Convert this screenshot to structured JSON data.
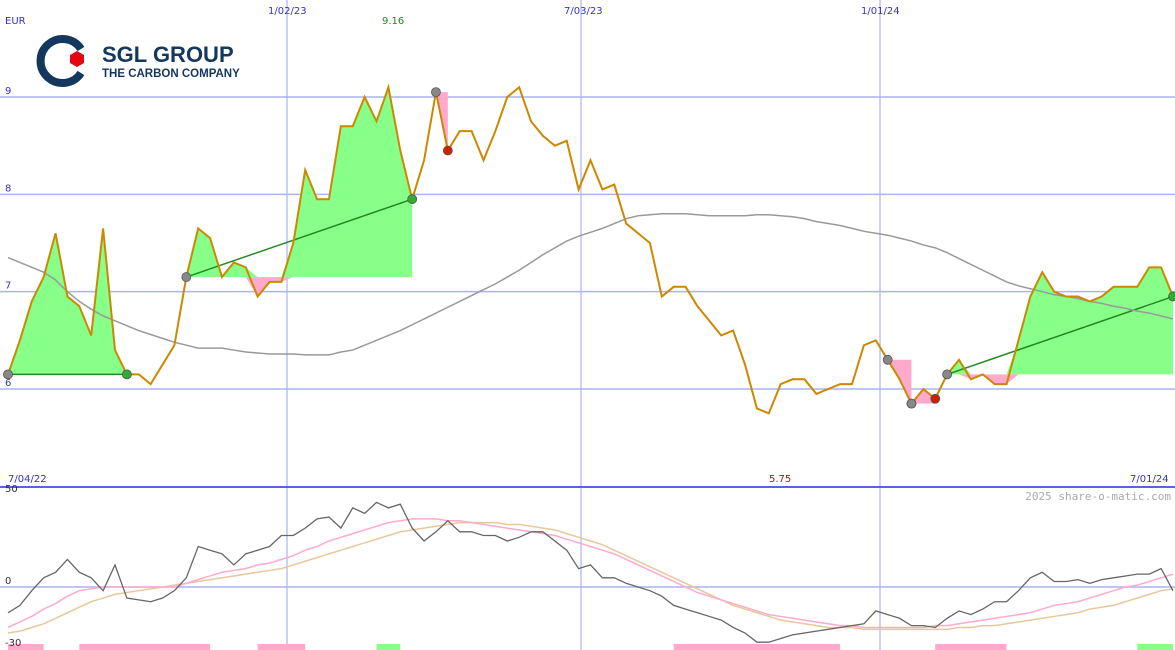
{
  "logo": {
    "name": "SGL GROUP",
    "tagline": "THE CARBON COMPANY"
  },
  "currency": "EUR",
  "copyright": "2025 share-o-matic.com",
  "top_date_labels": [
    "1/02/23",
    "7/03/23",
    "1/01/24"
  ],
  "start_label": "7/04/22",
  "end_label": "7/01/24",
  "high_label": "9.16",
  "low_label": "5.75",
  "colors": {
    "price": "#cc8800",
    "ma": "#999999",
    "grid": "#aab4ee",
    "axis": "#3333cc",
    "gain": "#88ff88",
    "loss": "#ffaacc",
    "macd": "#666666",
    "sig1": "#ffaacc",
    "sig2": "#e6c89a"
  },
  "chart_data": [
    {
      "type": "line",
      "ylim": [
        5.05,
        9.95
      ],
      "yticks": [
        6,
        7,
        8,
        9
      ],
      "x": [
        0,
        1,
        2,
        3,
        4,
        5,
        6,
        7,
        8,
        9,
        10,
        11,
        12,
        13,
        14,
        15,
        16,
        17,
        18,
        19,
        20,
        21,
        22,
        23,
        24,
        25,
        26,
        27,
        28,
        29,
        30,
        31,
        32,
        33,
        34,
        35,
        36,
        37,
        38,
        39,
        40,
        41,
        42,
        43,
        44,
        45,
        46,
        47,
        48,
        49,
        50,
        51,
        52,
        53,
        54,
        55,
        56,
        57,
        58,
        59,
        60,
        61,
        62,
        63,
        64,
        65,
        66,
        67,
        68,
        69,
        70,
        71,
        72,
        73,
        74,
        75,
        76,
        77,
        78,
        79,
        80,
        81,
        82,
        83,
        84,
        85,
        86,
        87,
        88,
        89,
        90,
        91,
        92,
        93,
        94,
        95,
        96,
        97,
        98
      ],
      "price": [
        6.15,
        6.5,
        6.9,
        7.15,
        7.6,
        6.95,
        6.85,
        6.55,
        7.65,
        6.4,
        6.15,
        6.15,
        6.05,
        6.25,
        6.45,
        7.15,
        7.65,
        7.55,
        7.15,
        7.3,
        7.25,
        6.95,
        7.1,
        7.1,
        7.5,
        8.25,
        7.95,
        7.95,
        8.7,
        8.7,
        9.0,
        8.75,
        9.1,
        8.45,
        7.95,
        8.35,
        9.05,
        8.45,
        8.65,
        8.65,
        8.35,
        8.65,
        9.0,
        9.1,
        8.75,
        8.6,
        8.5,
        8.55,
        8.05,
        8.35,
        8.05,
        8.1,
        7.7,
        7.6,
        7.5,
        6.95,
        7.05,
        7.05,
        6.85,
        6.7,
        6.55,
        6.6,
        6.25,
        5.8,
        5.75,
        6.05,
        6.1,
        6.1,
        5.95,
        6.0,
        6.05,
        6.05,
        6.45,
        6.5,
        6.3,
        6.1,
        5.85,
        6.0,
        5.9,
        6.15,
        6.3,
        6.1,
        6.15,
        6.05,
        6.05,
        6.5,
        6.95,
        7.2,
        7.0,
        6.95,
        6.95,
        6.9,
        6.95,
        7.05,
        7.05,
        7.05,
        7.25,
        7.25,
        6.95
      ],
      "moving_average": [
        7.35,
        7.3,
        7.25,
        7.2,
        7.12,
        7.0,
        6.9,
        6.82,
        6.75,
        6.7,
        6.65,
        6.6,
        6.56,
        6.52,
        6.48,
        6.45,
        6.42,
        6.42,
        6.42,
        6.4,
        6.38,
        6.37,
        6.36,
        6.36,
        6.36,
        6.35,
        6.35,
        6.35,
        6.38,
        6.4,
        6.45,
        6.5,
        6.55,
        6.6,
        6.66,
        6.72,
        6.78,
        6.84,
        6.9,
        6.96,
        7.02,
        7.08,
        7.15,
        7.22,
        7.3,
        7.38,
        7.45,
        7.52,
        7.57,
        7.61,
        7.65,
        7.7,
        7.75,
        7.78,
        7.79,
        7.8,
        7.8,
        7.8,
        7.79,
        7.78,
        7.78,
        7.78,
        7.78,
        7.79,
        7.79,
        7.78,
        7.77,
        7.75,
        7.72,
        7.7,
        7.68,
        7.65,
        7.62,
        7.6,
        7.58,
        7.55,
        7.52,
        7.48,
        7.45,
        7.4,
        7.34,
        7.28,
        7.22,
        7.16,
        7.1,
        7.06,
        7.03,
        7.0,
        6.97,
        6.95,
        6.93,
        6.9,
        6.88,
        6.85,
        6.83,
        6.8,
        6.78,
        6.75,
        6.72
      ],
      "buy_signals": [
        {
          "start": 0,
          "end": 10
        },
        {
          "start": 15,
          "end": 34
        },
        {
          "start": 79,
          "end": 98
        }
      ],
      "sell_signals": [
        {
          "start": 36,
          "end": 37
        },
        {
          "start": 74,
          "end": 76
        },
        {
          "start": 76,
          "end": 78
        }
      ]
    },
    {
      "type": "line",
      "ylim": [
        -30,
        50
      ],
      "yticks": [
        -30,
        0,
        50
      ],
      "macd": [
        -14,
        -10,
        -2,
        5,
        8,
        15,
        8,
        5,
        -2,
        12,
        -6,
        -7,
        -8,
        -6,
        -2,
        5,
        22,
        20,
        18,
        12,
        18,
        20,
        22,
        28,
        28,
        32,
        37,
        38,
        32,
        43,
        40,
        46,
        43,
        45,
        32,
        25,
        30,
        36,
        30,
        30,
        28,
        28,
        25,
        27,
        30,
        30,
        25,
        20,
        10,
        12,
        5,
        5,
        2,
        0,
        -2,
        -5,
        -10,
        -12,
        -14,
        -16,
        -18,
        -22,
        -25,
        -30,
        -30,
        -28,
        -26,
        -25,
        -24,
        -23,
        -22,
        -21,
        -20,
        -13,
        -15,
        -17,
        -21,
        -21,
        -22,
        -17,
        -13,
        -15,
        -12,
        -8,
        -8,
        -2,
        5,
        8,
        3,
        3,
        4,
        2,
        4,
        5,
        6,
        7,
        7,
        10,
        -2
      ],
      "signal_fast": [
        -22,
        -19,
        -16,
        -12,
        -9,
        -5,
        -2,
        -1,
        0,
        0,
        0,
        0,
        0,
        0,
        0,
        2,
        4,
        6,
        8,
        9,
        10,
        12,
        13,
        15,
        17,
        20,
        22,
        25,
        27,
        29,
        31,
        33,
        35,
        36,
        37,
        37,
        37,
        36,
        36,
        35,
        34,
        33,
        32,
        31,
        30,
        29,
        28,
        26,
        24,
        22,
        20,
        18,
        15,
        12,
        9,
        6,
        3,
        0,
        -3,
        -5,
        -7,
        -9,
        -11,
        -13,
        -15,
        -16,
        -17,
        -18,
        -19,
        -20,
        -21,
        -21,
        -22,
        -22,
        -22,
        -22,
        -22,
        -22,
        -21,
        -21,
        -20,
        -19,
        -18,
        -17,
        -16,
        -15,
        -14,
        -12,
        -10,
        -9,
        -8,
        -6,
        -4,
        -2,
        0,
        1,
        3,
        5,
        7
      ],
      "signal_slow": [
        -25,
        -24,
        -22,
        -20,
        -17,
        -14,
        -11,
        -8,
        -6,
        -4,
        -3,
        -2,
        -1,
        0,
        1,
        2,
        3,
        4,
        5,
        6,
        7,
        8,
        9,
        10,
        12,
        14,
        16,
        18,
        20,
        22,
        24,
        26,
        28,
        30,
        31,
        32,
        33,
        34,
        35,
        35,
        35,
        35,
        34,
        34,
        33,
        32,
        31,
        29,
        27,
        25,
        23,
        20,
        17,
        14,
        11,
        8,
        5,
        2,
        -1,
        -4,
        -7,
        -10,
        -12,
        -14,
        -16,
        -18,
        -19,
        -20,
        -21,
        -22,
        -22,
        -22,
        -23,
        -23,
        -23,
        -23,
        -23,
        -23,
        -23,
        -23,
        -22,
        -22,
        -21,
        -21,
        -20,
        -19,
        -18,
        -17,
        -16,
        -15,
        -14,
        -12,
        -11,
        -10,
        -8,
        -6,
        -4,
        -2,
        -1
      ],
      "histogram": [
        {
          "start": 0,
          "end": 3,
          "kind": "loss"
        },
        {
          "start": 6,
          "end": 17,
          "kind": "loss"
        },
        {
          "start": 21,
          "end": 25,
          "kind": "loss"
        },
        {
          "start": 31,
          "end": 33,
          "kind": "gain"
        },
        {
          "start": 56,
          "end": 70,
          "kind": "loss"
        },
        {
          "start": 78,
          "end": 84,
          "kind": "loss"
        },
        {
          "start": 95,
          "end": 98,
          "kind": "gain"
        }
      ]
    }
  ]
}
